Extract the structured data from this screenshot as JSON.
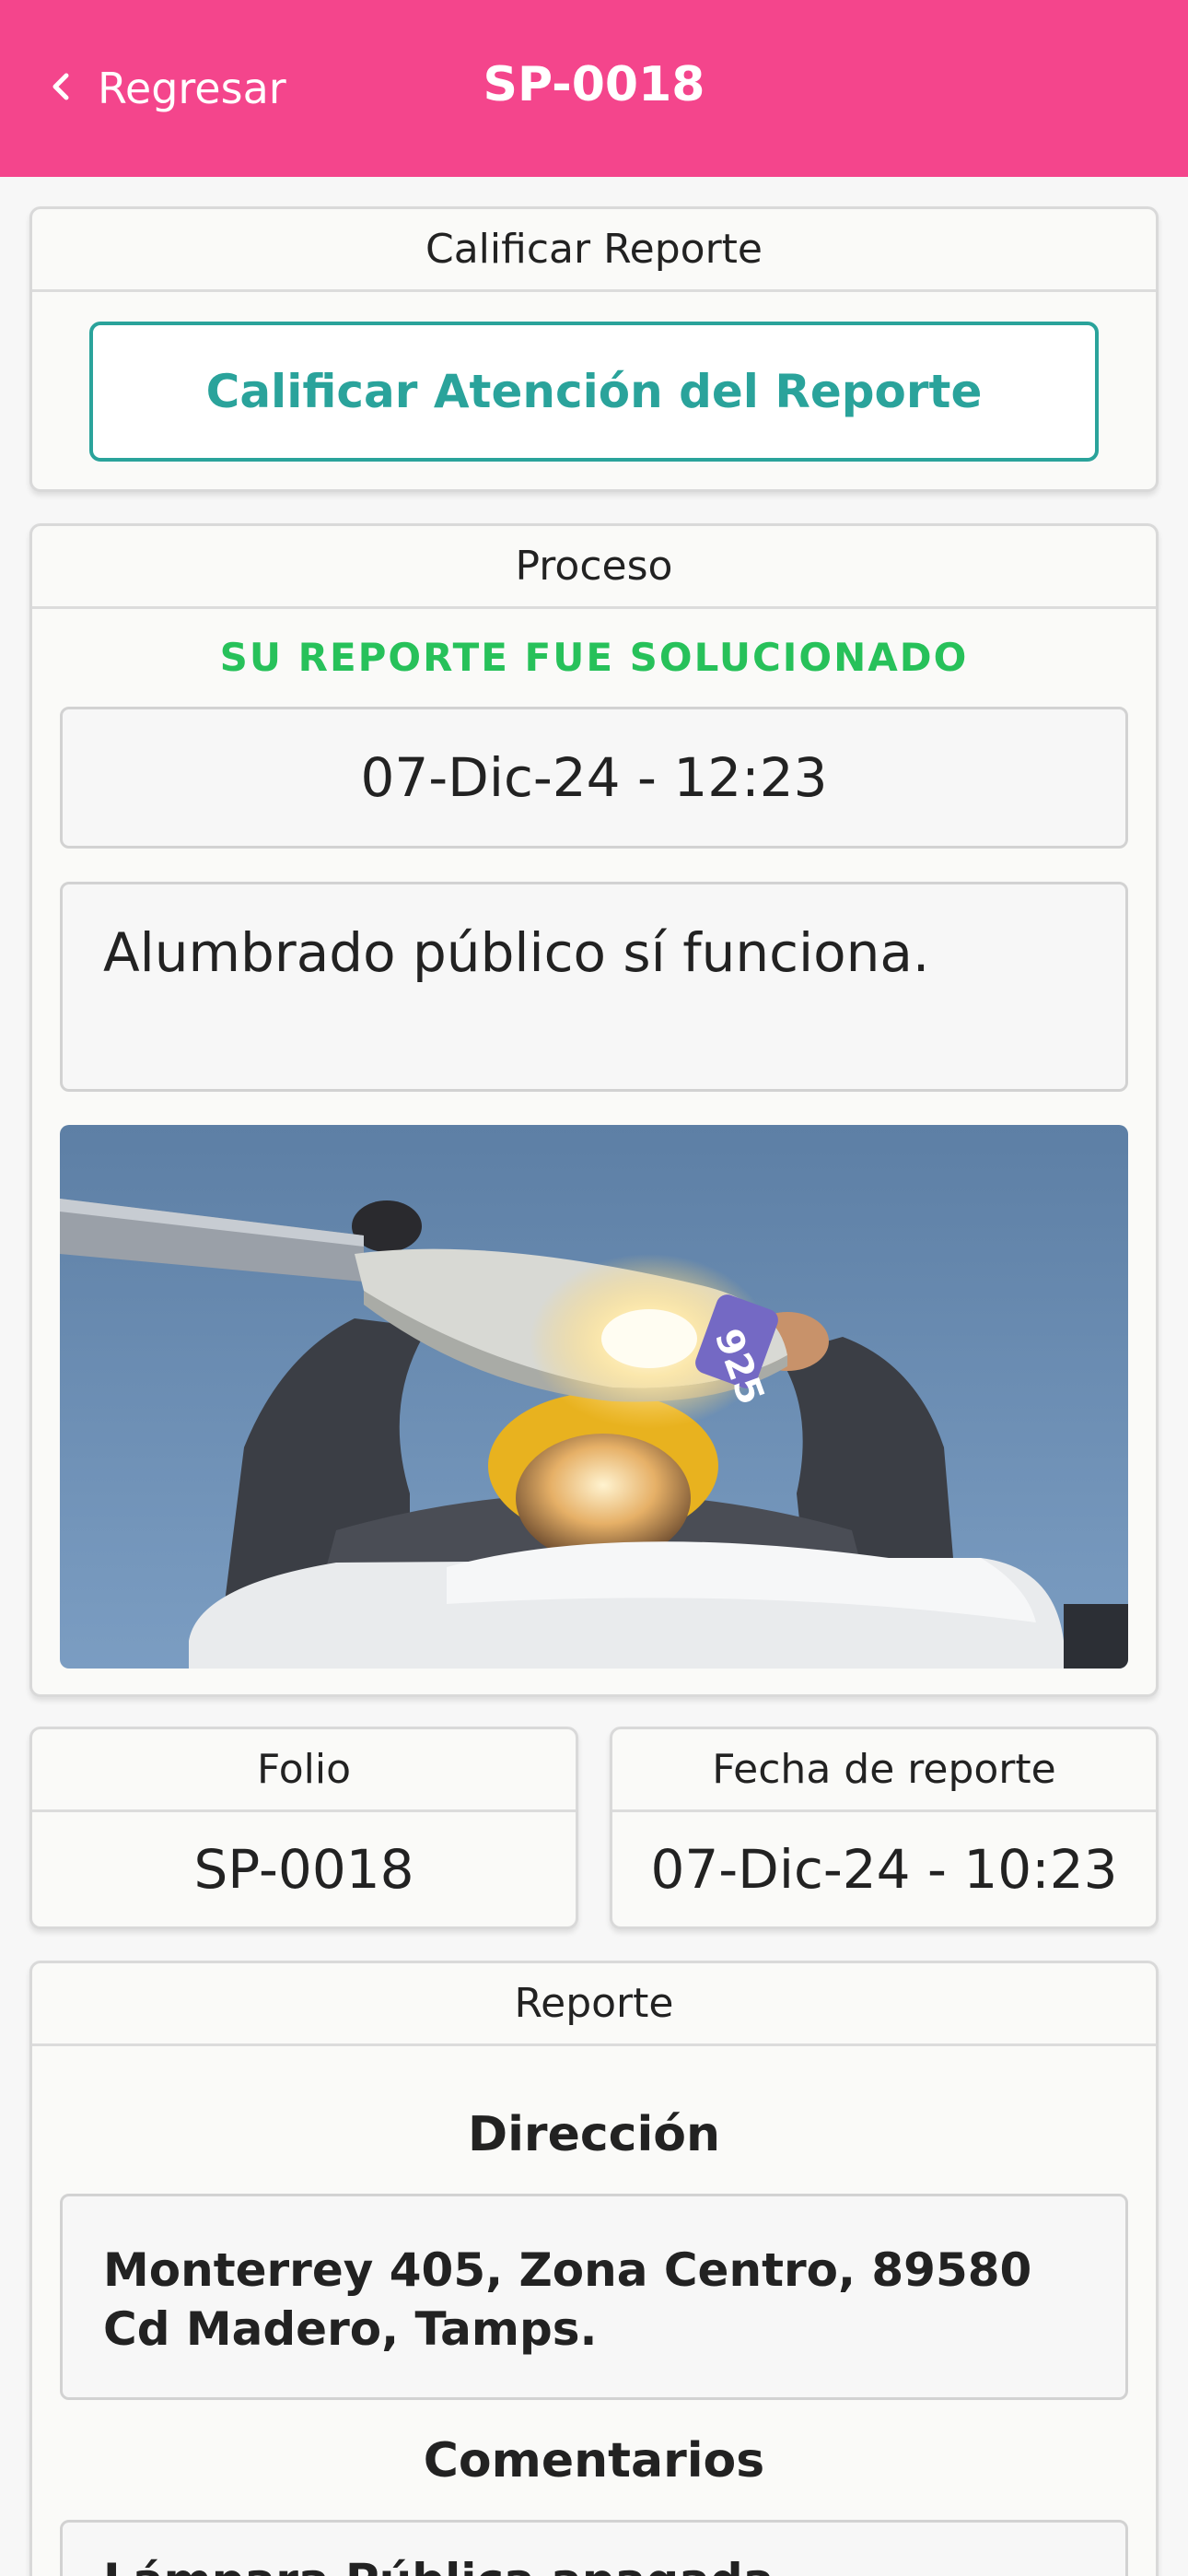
{
  "header": {
    "back_label": "Regresar",
    "title": "SP-0018",
    "color": "#f4458c"
  },
  "rating": {
    "heading": "Calificar Reporte",
    "button_label": "Calificar Atención del Reporte",
    "accent": "#2aa39b"
  },
  "process": {
    "heading": "Proceso",
    "status": "SU REPORTE FUE SOLUCIONADO",
    "status_color": "#27c15a",
    "date": "07-Dic-24 - 12:23",
    "description": "Alumbrado público sí funciona."
  },
  "folio": {
    "heading": "Folio",
    "value": "SP-0018"
  },
  "report_date": {
    "heading": "Fecha de reporte",
    "value": "07-Dic-24 - 10:23"
  },
  "report": {
    "heading": "Reporte",
    "address_title": "Dirección",
    "address": "Monterrey 405, Zona Centro, 89580 Cd Madero, Tamps.",
    "comments_title": "Comentarios",
    "comments": "Lámpara Pública apagada"
  }
}
